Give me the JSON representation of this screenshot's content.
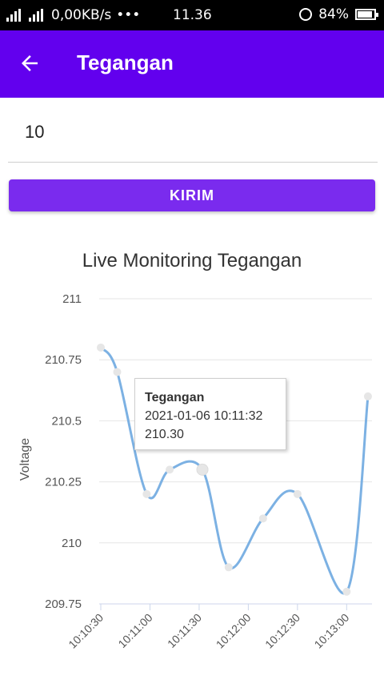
{
  "status_bar": {
    "network": "0,00KB/s",
    "dots": "•••",
    "time": "11.36",
    "battery": "84%",
    "battery_level": 0.84
  },
  "app_bar": {
    "title": "Tegangan",
    "back_icon": "arrow-left-icon"
  },
  "input": {
    "value": "10"
  },
  "button": {
    "label": "KIRIM"
  },
  "tooltip": {
    "series": "Tegangan",
    "datetime": "2021-01-06 10:11:32",
    "value": "210.30"
  },
  "chart_data": {
    "type": "line",
    "title": "Live Monitoring Tegangan",
    "ylabel": "Voltage",
    "xlabel": "",
    "ylim": [
      209.75,
      211
    ],
    "yticks": [
      "211",
      "210.75",
      "210.5",
      "210.25",
      "210",
      "209.75"
    ],
    "xticks": [
      "10:10:30",
      "10:11:00",
      "10:11:30",
      "10:12:00",
      "10:12:30",
      "10:13:00"
    ],
    "series": [
      {
        "color": "#7cb1e3",
        "points": [
          {
            "t": "10:10:30",
            "v": 210.8
          },
          {
            "t": "10:10:40",
            "v": 210.7
          },
          {
            "t": "10:10:58",
            "v": 210.2
          },
          {
            "t": "10:11:12",
            "v": 210.3
          },
          {
            "t": "10:11:32",
            "v": 210.3
          },
          {
            "t": "10:11:48",
            "v": 209.9
          },
          {
            "t": "10:12:09",
            "v": 210.1
          },
          {
            "t": "10:12:30",
            "v": 210.2
          },
          {
            "t": "10:13:00",
            "v": 209.8
          },
          {
            "t": "10:13:13",
            "v": 210.6
          }
        ]
      }
    ],
    "x_range": [
      "10:10:30",
      "10:13:14"
    ],
    "grid": true,
    "highlighted_index": 4
  }
}
